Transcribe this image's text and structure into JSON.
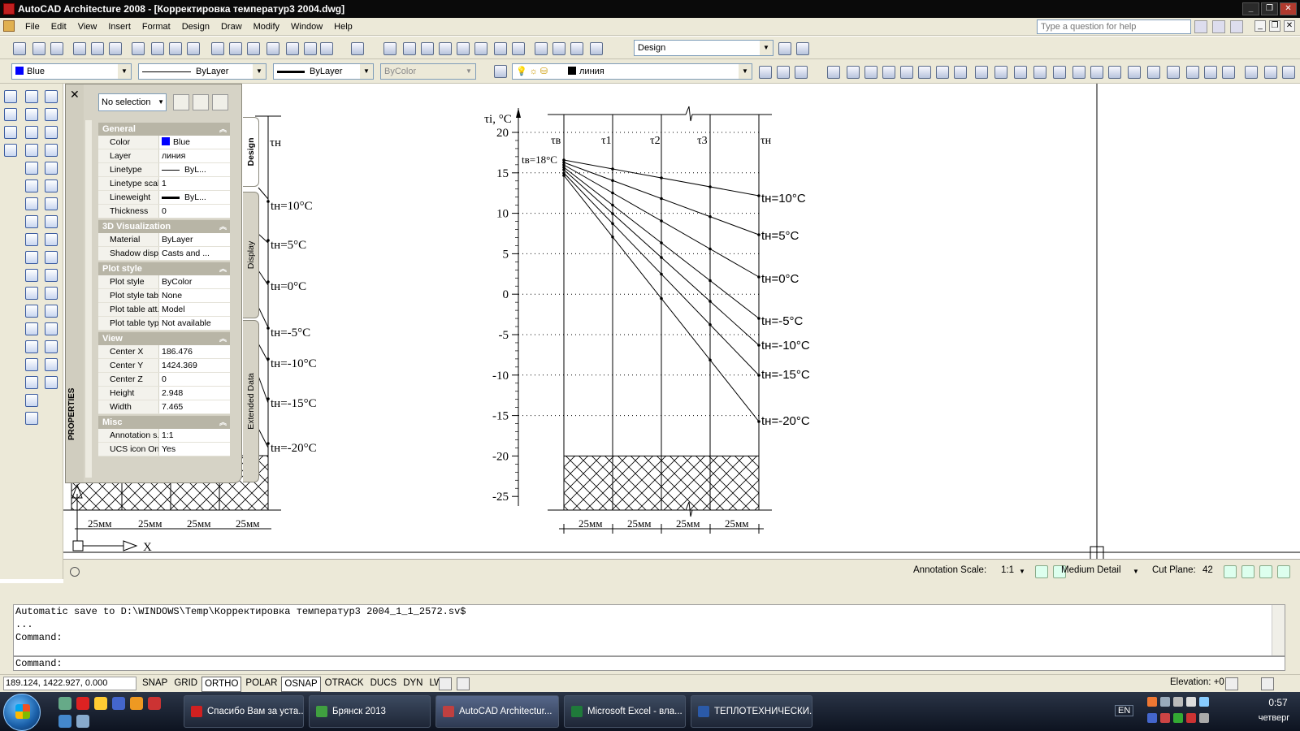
{
  "window": {
    "title": "AutoCAD Architecture 2008 - [Корректировка температур3 2004.dwg]",
    "controls": [
      "minimize",
      "restore",
      "close"
    ]
  },
  "menu": {
    "items": [
      "File",
      "Edit",
      "View",
      "Insert",
      "Format",
      "Design",
      "Draw",
      "Modify",
      "Window",
      "Help"
    ],
    "help_placeholder": "Type a question for help"
  },
  "toolbar1": {
    "workspace": "Design"
  },
  "toolbar2": {
    "color": "Blue",
    "color_hex": "#0000ff",
    "linetype": "ByLayer",
    "lineweight": "ByLayer",
    "plotstyle": "ByColor",
    "layer": "линия"
  },
  "properties": {
    "title": "PROPERTIES",
    "selection": "No selection",
    "tabs": [
      "Design",
      "Display",
      "Extended Data"
    ],
    "sections": [
      {
        "name": "General",
        "rows": [
          {
            "label": "Color",
            "value": "Blue"
          },
          {
            "label": "Layer",
            "value": "линия"
          },
          {
            "label": "Linetype",
            "value": "ByL..."
          },
          {
            "label": "Linetype scale",
            "value": "1"
          },
          {
            "label": "Lineweight",
            "value": "ByL..."
          },
          {
            "label": "Thickness",
            "value": "0"
          }
        ]
      },
      {
        "name": "3D Visualization",
        "rows": [
          {
            "label": "Material",
            "value": "ByLayer"
          },
          {
            "label": "Shadow display",
            "value": "Casts and ..."
          }
        ]
      },
      {
        "name": "Plot style",
        "rows": [
          {
            "label": "Plot style",
            "value": "ByColor"
          },
          {
            "label": "Plot style table",
            "value": "None"
          },
          {
            "label": "Plot table att...",
            "value": "Model"
          },
          {
            "label": "Plot table type",
            "value": "Not available"
          }
        ]
      },
      {
        "name": "View",
        "rows": [
          {
            "label": "Center X",
            "value": "186.476"
          },
          {
            "label": "Center Y",
            "value": "1424.369"
          },
          {
            "label": "Center Z",
            "value": "0"
          },
          {
            "label": "Height",
            "value": "2.948"
          },
          {
            "label": "Width",
            "value": "7.465"
          }
        ]
      },
      {
        "name": "Misc",
        "rows": [
          {
            "label": "Annotation s...",
            "value": "1:1"
          },
          {
            "label": "UCS icon On",
            "value": "Yes"
          }
        ]
      }
    ]
  },
  "drawing": {
    "left_panel": {
      "header": "τн",
      "labels": [
        "tн=10°C",
        "tн=5°C",
        "tн=0°C",
        "tн=-5°C",
        "tн=-10°C",
        "tн=-15°C",
        "tн=-20°C"
      ],
      "dims": [
        "25мм",
        "25мм",
        "25мм",
        "25мм"
      ],
      "axis_label": "X"
    },
    "right_panel": {
      "y_title": "τi, °C",
      "y_ticks": [
        "20",
        "15",
        "10",
        "5",
        "0",
        "-5",
        "-10",
        "-15",
        "-20",
        "-25"
      ],
      "column_heads": [
        "τв",
        "τ1",
        "τ2",
        "τ3",
        "τн"
      ],
      "inside_label": "tв=18°C",
      "outside_labels": [
        "tн=10°C",
        "tн=5°C",
        "tн=0°C",
        "tн=-5°C",
        "tн=-10°C",
        "tн=-15°C",
        "tн=-20°C"
      ],
      "dims": [
        "25мм",
        "25мм",
        "25мм",
        "25мм"
      ]
    }
  },
  "layoutbar": {
    "annotation_label": "Annotation Scale:",
    "annotation_value": "1:1",
    "detail": "Medium Detail",
    "cut_plane_label": "Cut Plane:",
    "cut_plane_value": "42"
  },
  "command": {
    "history": [
      "Automatic save to D:\\WINDOWS\\Temp\\Корректировка температур3 2004_1_1_2572.sv$",
      "...",
      "Command:"
    ],
    "prompt": "Command:"
  },
  "status": {
    "coords": "189.124, 1422.927, 0.000",
    "toggles": [
      {
        "label": "SNAP",
        "on": false
      },
      {
        "label": "GRID",
        "on": false
      },
      {
        "label": "ORTHO",
        "on": true
      },
      {
        "label": "POLAR",
        "on": false
      },
      {
        "label": "OSNAP",
        "on": true
      },
      {
        "label": "OTRACK",
        "on": false
      },
      {
        "label": "DUCS",
        "on": false
      },
      {
        "label": "DYN",
        "on": false
      },
      {
        "label": "LWT",
        "on": false
      }
    ],
    "elevation": "Elevation:  +0"
  },
  "taskbar": {
    "buttons": [
      {
        "label": "Спасибо Вам за уста...",
        "color": "#d02020"
      },
      {
        "label": "Брянск 2013",
        "color": "#40a040"
      },
      {
        "label": "AutoCAD Architectur...",
        "color": "#c04040"
      },
      {
        "label": "Microsoft Excel - вла...",
        "color": "#1f7a3a"
      },
      {
        "label": "ТЕПЛОТЕХНИЧЕСКИ...",
        "color": "#2b5aa8"
      }
    ],
    "lang": "EN",
    "time": "0:57",
    "day": "четверг"
  }
}
